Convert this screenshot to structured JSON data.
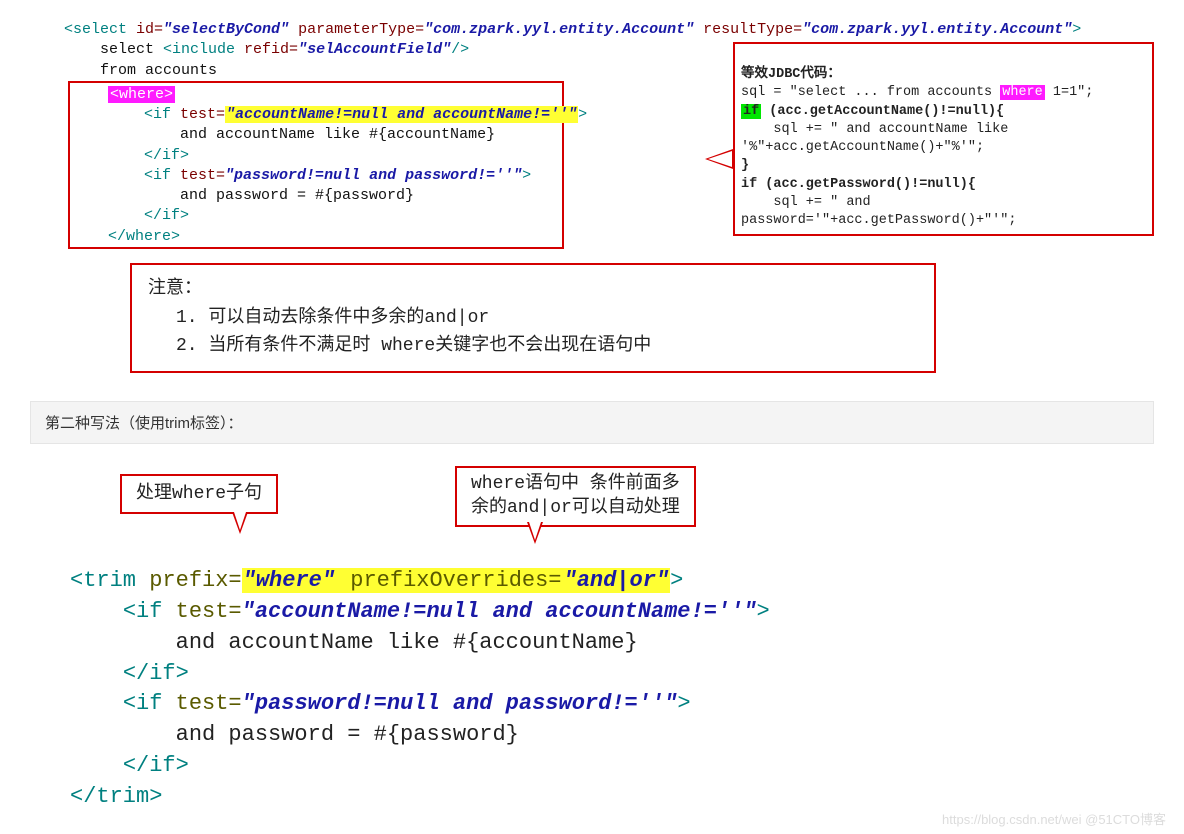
{
  "top": {
    "l1_open": "<select",
    "l1_idattr": " id=",
    "l1_idval": "\"selectByCond\"",
    "l1_ptattr": " parameterType=",
    "l1_ptval": "\"com.zpark.yyl.entity.Account\"",
    "l1_rtattr": " resultType=",
    "l1_rtval": "\"com.zpark.yyl.entity.Account\"",
    "l2_select": "    select ",
    "l2_incopen": "<include",
    "l2_refattr": " refid=",
    "l2_refval": "\"selAccountField\"",
    "l2_incclose": "/>",
    "l3": "    from accounts",
    "where_open": "<where>",
    "if1_open": "<if",
    "if_testattr": " test=",
    "if1_testval": "\"accountName!=null and accountName!=''\"",
    "if1_body": "            and accountName like #{accountName}",
    "if_close": "</if>",
    "if2_testval": "\"password!=null and password!=''\"",
    "if2_body": "            and password = #{password}",
    "where_close": "</where>"
  },
  "jdbc": {
    "title": "等效JDBC代码：",
    "l1a": "sql = \"select ... from accounts ",
    "l1_where": "where",
    "l1b": " 1=1\";",
    "l2_if": "if",
    "l2_rest": " (acc.getAccountName()!=null){",
    "l3": "    sql += \" and accountName like '%\"+acc.getAccountName()+\"%'\";",
    "l4": "}",
    "l5": "if (acc.getPassword()!=null){",
    "l6": "    sql += \" and password='\"+acc.getPassword()+\"'\";"
  },
  "note": {
    "h": "注意：",
    "n1": "1. 可以自动去除条件中多余的and|or",
    "n2": "2. 当所有条件不满足时 where关键字也不会出现在语句中"
  },
  "section2": "第二种写法（使用trim标签）：",
  "callout1": "处理where子句",
  "callout2a": "where语句中 条件前面多",
  "callout2b": "余的and|or可以自动处理",
  "trim": {
    "open": "<trim",
    "prefixattr": " prefix=",
    "prefixval": "\"where\"",
    "poattr": " prefixOverrides=",
    "poval": "\"and|or\"",
    "if1_open": "<if",
    "testattr": " test=",
    "if1_val": "\"accountName!=null and accountName!=''\"",
    "if1_body": "        and accountName like #{accountName}",
    "if_close": "</if>",
    "if2_val": "\"password!=null and password!=''\"",
    "if2_body": "        and password = #{password}",
    "close": "</trim>"
  },
  "watermark": "https://blog.csdn.net/wei @51CTO博客"
}
